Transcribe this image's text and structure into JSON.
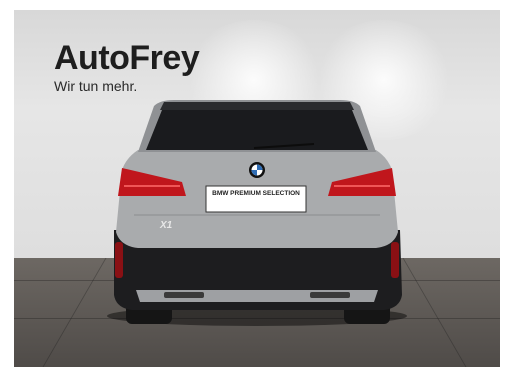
{
  "brand": {
    "name": "AutoFrey",
    "tagline": "Wir tun mehr."
  },
  "vehicle": {
    "model_badge": "X1",
    "plate_text": "BMW PREMIUM SELECTION"
  },
  "colors": {
    "car_body": "#a9abad",
    "car_lower": "#1d1d1f",
    "taillight": "#c0161c"
  }
}
